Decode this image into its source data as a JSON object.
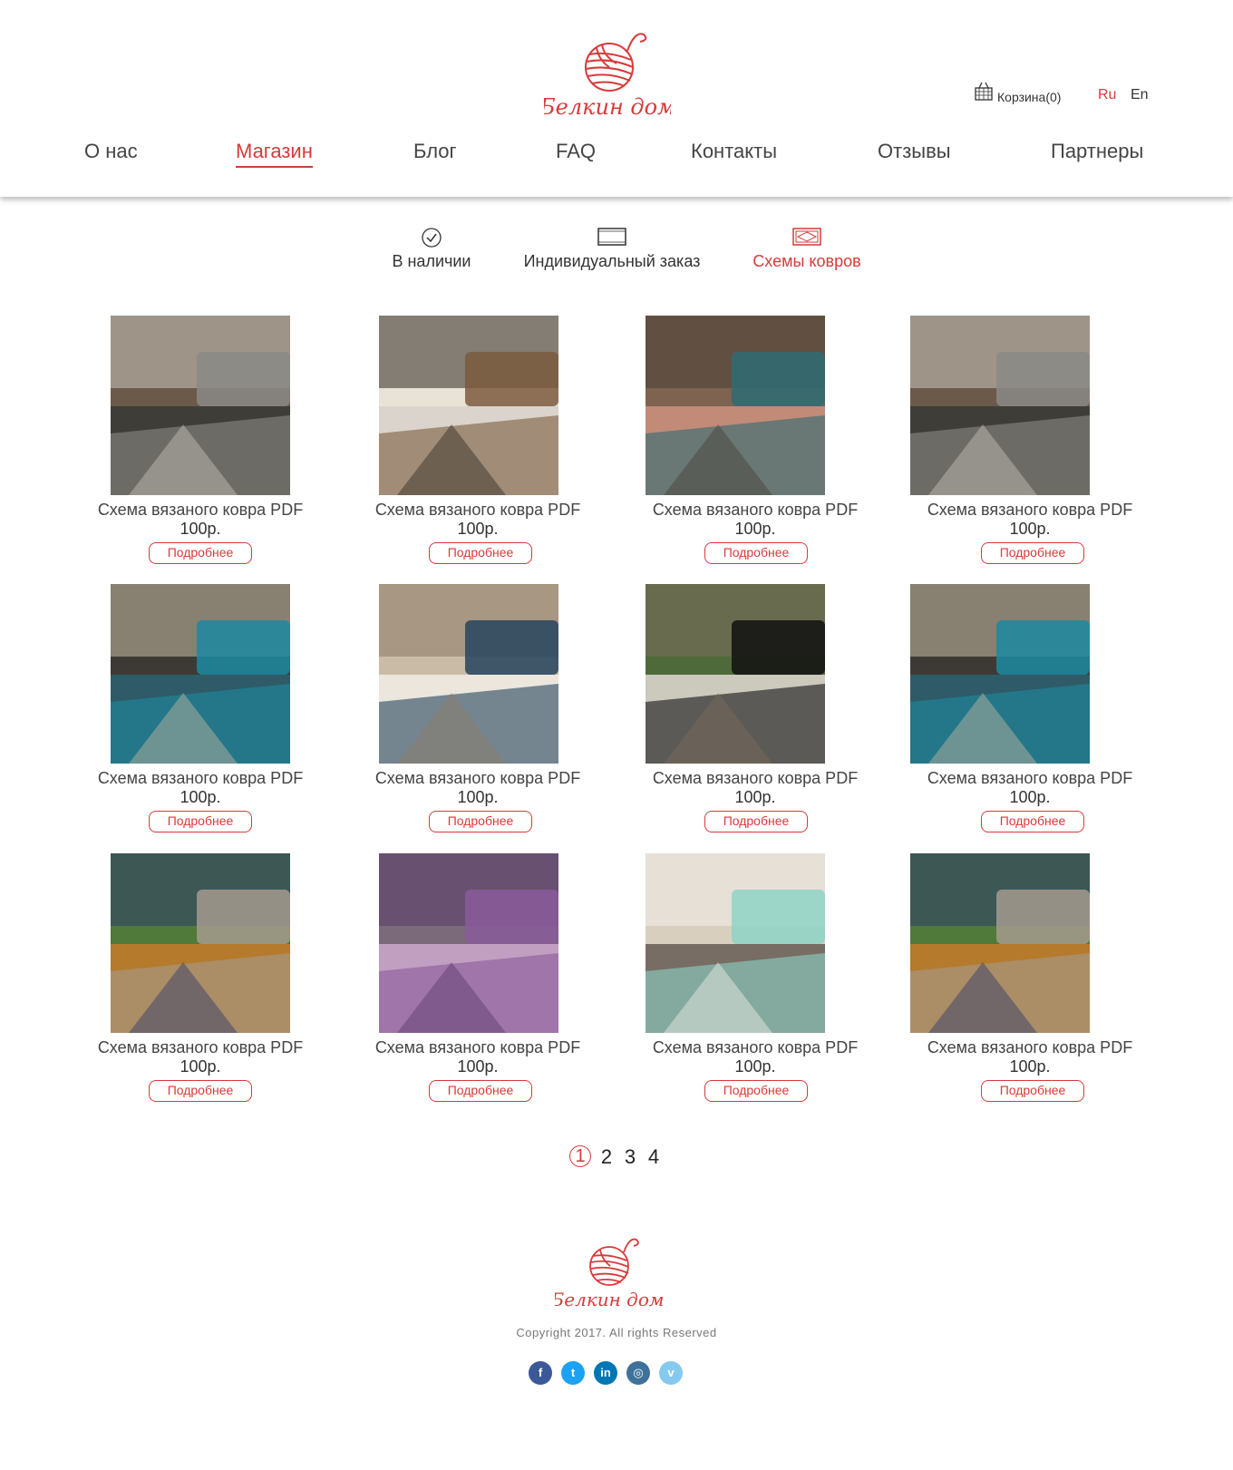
{
  "header": {
    "brand": "Белкин дом",
    "cart_label": "Корзина(0)",
    "lang_ru": "Ru",
    "lang_en": "En",
    "nav": [
      {
        "label": "О нас"
      },
      {
        "label": "Магазин",
        "active": true
      },
      {
        "label": "Блог"
      },
      {
        "label": "FAQ"
      },
      {
        "label": "Контакты"
      },
      {
        "label": "Отзывы"
      },
      {
        "label": "Партнеры"
      }
    ]
  },
  "categories": [
    {
      "label": "В наличии",
      "icon": "check-circle-icon"
    },
    {
      "label": "Индивидуальный заказ",
      "icon": "frame-icon"
    },
    {
      "label": "Схемы ковров",
      "icon": "rug-icon",
      "active": true
    }
  ],
  "products": [
    {
      "title": "Схема вязаного ковра PDF",
      "price": "100р.",
      "button": "Подробнее"
    },
    {
      "title": "Схема вязаного ковра PDF",
      "price": "100р.",
      "button": "Подробнее"
    },
    {
      "title": "Схема вязаного ковра PDF",
      "price": "100р.",
      "button": "Подробнее"
    },
    {
      "title": "Схема вязаного ковра PDF",
      "price": "100р.",
      "button": "Подробнее"
    },
    {
      "title": "Схема вязаного ковра PDF",
      "price": "100р.",
      "button": "Подробнее"
    },
    {
      "title": "Схема вязаного ковра PDF",
      "price": "100р.",
      "button": "Подробнее"
    },
    {
      "title": "Схема вязаного ковра PDF",
      "price": "100р.",
      "button": "Подробнее"
    },
    {
      "title": "Схема вязаного ковра PDF",
      "price": "100р.",
      "button": "Подробнее"
    },
    {
      "title": "Схема вязаного ковра PDF",
      "price": "100р.",
      "button": "Подробнее"
    },
    {
      "title": "Схема вязаного ковра PDF",
      "price": "100р.",
      "button": "Подробнее"
    },
    {
      "title": "Схема вязаного ковра PDF",
      "price": "100р.",
      "button": "Подробнее"
    },
    {
      "title": "Схема вязаного ковра PDF",
      "price": "100р.",
      "button": "Подробнее"
    }
  ],
  "pagination": {
    "pages": [
      "1",
      "2",
      "3",
      "4"
    ],
    "current": "1"
  },
  "footer": {
    "brand": "Белкин дом",
    "copyright": "Copyright 2017. All rights Reserved",
    "social": [
      {
        "icon": "facebook-icon",
        "glyph": "f",
        "color": "#3b5998"
      },
      {
        "icon": "twitter-icon",
        "glyph": "t",
        "color": "#1da1f2"
      },
      {
        "icon": "linkedin-icon",
        "glyph": "in",
        "color": "#0077b5"
      },
      {
        "icon": "instagram-icon",
        "glyph": "◎",
        "color": "#3f729b"
      },
      {
        "icon": "vimeo-icon",
        "glyph": "v",
        "color": "#86c9ef"
      }
    ]
  },
  "colors": {
    "accent": "#d83a3a",
    "text": "#333333"
  }
}
